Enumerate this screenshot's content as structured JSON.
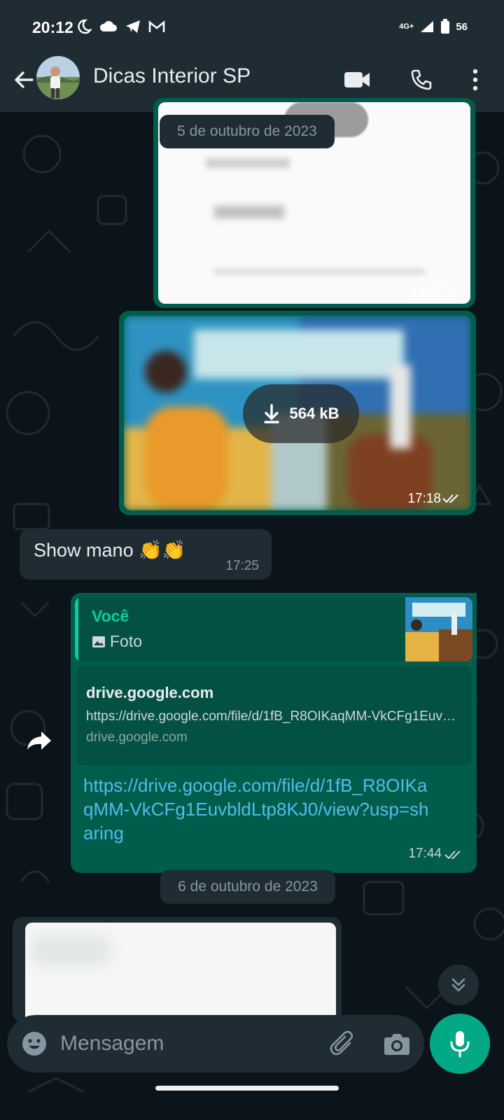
{
  "status_bar": {
    "time": "20:12",
    "network": "4G+",
    "battery": "56"
  },
  "header": {
    "contact_name": "Dicas Interior SP"
  },
  "messages": [
    {
      "type": "image",
      "direction": "outgoing",
      "time": "17:17",
      "status": "read"
    },
    {
      "type": "image",
      "direction": "outgoing",
      "download_size": "564 kB",
      "time": "17:18",
      "status": "read"
    },
    {
      "type": "text",
      "direction": "incoming",
      "text": "Show mano 👏👏",
      "time": "17:25"
    },
    {
      "type": "link",
      "direction": "outgoing",
      "quote": {
        "author": "Você",
        "media_label": "Foto"
      },
      "preview": {
        "title": "drive.google.com",
        "url": "https://drive.google.com/file/d/1fB_R8OIKaqMM-VkCFg1EuvbldLtp8KJ0/view?usp=sharing",
        "domain": "drive.google.com"
      },
      "link_text": "https://drive.google.com/file/d/1fB_R8OIKaqMM-VkCFg1EuvbldLtp8KJ0/view?usp=sharing",
      "time": "17:44",
      "status": "read"
    },
    {
      "type": "image",
      "direction": "incoming"
    }
  ],
  "date_chips": [
    "5 de outubro de 2023",
    "6 de outubro de 2023"
  ],
  "composer": {
    "placeholder": "Mensagem"
  },
  "colors": {
    "background": "#0b141a",
    "header": "#1f2c34",
    "outgoing_bubble": "#005c4b",
    "incoming_bubble": "#1f2c34",
    "accent": "#00a884",
    "link": "#53bdeb"
  },
  "icons": {
    "back": "arrow-left-icon",
    "video_call": "video-camera-icon",
    "voice_call": "phone-icon",
    "menu": "more-vertical-icon",
    "forward": "forward-icon",
    "scroll_down": "double-chevron-down-icon",
    "emoji": "emoji-icon",
    "attach": "paperclip-icon",
    "camera": "camera-icon",
    "mic": "microphone-icon"
  }
}
